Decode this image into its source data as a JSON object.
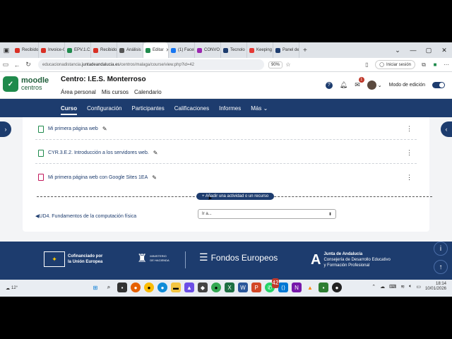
{
  "browser": {
    "tabs": [
      {
        "label": "Recibido",
        "color": "#d93025"
      },
      {
        "label": "Invoice-QO",
        "color": "#d93025"
      },
      {
        "label": "EPV.1.C",
        "color": "#1f8a4c"
      },
      {
        "label": "Recibido",
        "color": "#d93025"
      },
      {
        "label": "Análisis",
        "color": "#555555"
      },
      {
        "label": "Editar",
        "color": "#1f8a4c",
        "active": true
      },
      {
        "label": "(1) Faceb",
        "color": "#1877f2"
      },
      {
        "label": "CONVO",
        "color": "#9c27b0"
      },
      {
        "label": "Tecnolo",
        "color": "#1d3c6e"
      },
      {
        "label": "Keeping",
        "color": "#e53935"
      },
      {
        "label": "Panel de",
        "color": "#1d3c6e"
      }
    ],
    "url_prefix": "educacionadistancia.",
    "url_domain": "juntadeandalucia.es",
    "url_rest": "/centros/malaga/course/view.php?id=42",
    "zoom": "90%",
    "signin": "Iniciar sesión"
  },
  "header": {
    "logo_line1": "moodle",
    "logo_line2": "centros",
    "centro_label": "Centro:",
    "centro_name": "I.E.S. Monterroso",
    "nav": [
      "Área personal",
      "Mis cursos",
      "Calendario"
    ],
    "messages_badge": "1",
    "edit_mode": "Modo de edición"
  },
  "course_nav": [
    "Curso",
    "Configuración",
    "Participantes",
    "Calificaciones",
    "Informes",
    "Más"
  ],
  "activities": [
    {
      "name": "Mi primera página web",
      "type": "page"
    },
    {
      "name": "CYR.3.E.2. Introducción a los servidores web.",
      "type": "page"
    },
    {
      "name": "Mi primera página web con Google Sites 1EA",
      "type": "file"
    }
  ],
  "add_activity": "Añadir una actividad o un recurso",
  "prev_section": "UD4. Fundamentos de la computación física",
  "jump_to": "Ir a...",
  "footer": {
    "eu_line1": "Cofinanciado por",
    "eu_line2": "la Unión Europea",
    "ministerio_line1": "MINISTERIO",
    "ministerio_line2": "DE HACIENDA",
    "fondos": "Fondos Europeos",
    "junta_line1": "Junta de Andalucía",
    "junta_line2": "Consejería de Desarrollo Educativo",
    "junta_line3": "y Formación Profesional"
  },
  "taskbar": {
    "temperature": "12°",
    "time": "18:14",
    "date": "10/01/2026",
    "whatsapp_badge": "42"
  }
}
